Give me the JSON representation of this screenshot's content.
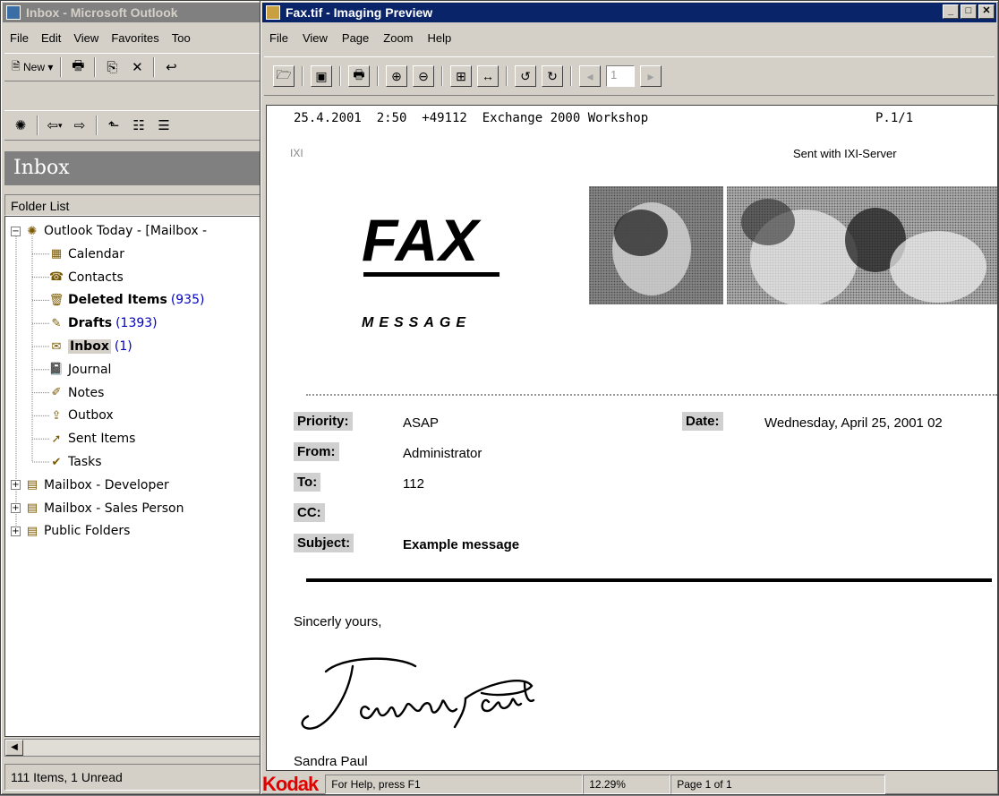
{
  "outlook": {
    "title": "Inbox - Microsoft Outlook",
    "menu": [
      "File",
      "Edit",
      "View",
      "Favorites",
      "Too"
    ],
    "toolbar1": {
      "new_label": "New"
    },
    "banner": "Inbox",
    "folder_header": "Folder List",
    "tree": [
      {
        "label": "Outlook Today - [Mailbox -",
        "icon": "outlook-today-icon",
        "level": 0,
        "expander": "-"
      },
      {
        "label": "Calendar",
        "icon": "calendar-icon",
        "level": 1
      },
      {
        "label": "Contacts",
        "icon": "contacts-icon",
        "level": 1
      },
      {
        "label": "Deleted Items",
        "count": "(935)",
        "bold": true,
        "icon": "deleted-items-icon",
        "level": 1
      },
      {
        "label": "Drafts",
        "count": "(1393)",
        "bold": true,
        "icon": "drafts-icon",
        "level": 1
      },
      {
        "label": "Inbox",
        "count": "(1)",
        "bold": true,
        "selected": true,
        "icon": "inbox-icon",
        "level": 1
      },
      {
        "label": "Journal",
        "icon": "journal-icon",
        "level": 1
      },
      {
        "label": "Notes",
        "icon": "notes-icon",
        "level": 1
      },
      {
        "label": "Outbox",
        "icon": "outbox-icon",
        "level": 1
      },
      {
        "label": "Sent Items",
        "icon": "sent-items-icon",
        "level": 1
      },
      {
        "label": "Tasks",
        "icon": "tasks-icon",
        "level": 1
      },
      {
        "label": "Mailbox - Developer",
        "icon": "mailbox-icon",
        "level": 0,
        "expander": "+"
      },
      {
        "label": "Mailbox - Sales Person",
        "icon": "mailbox-icon",
        "level": 0,
        "expander": "+"
      },
      {
        "label": "Public Folders",
        "icon": "public-folders-icon",
        "level": 0,
        "expander": "+"
      }
    ],
    "status": "111 Items, 1 Unread"
  },
  "imaging": {
    "title": "Fax.tif - Imaging Preview",
    "menu": [
      "File",
      "View",
      "Page",
      "Zoom",
      "Help"
    ],
    "page_input": "1",
    "status": {
      "brand": "Kodak",
      "help": "For Help, press F1",
      "zoom": "12.29%",
      "page": "Page 1 of 1"
    }
  },
  "fax": {
    "header_line": "25.4.2001  2:50  +49112  Exchange 2000 Workshop",
    "header_page": "P.1/1",
    "sent_with": "Sent with IXI-Server",
    "logo_text": "IXI",
    "heading": "FAX",
    "subheading": "MESSAGE",
    "fields": {
      "priority_label": "Priority:",
      "priority": "ASAP",
      "date_label": "Date:",
      "date": "Wednesday, April 25, 2001 02",
      "from_label": "From:",
      "from": "Administrator",
      "to_label": "To:",
      "to": "112",
      "cc_label": "CC:",
      "cc": "",
      "subject_label": "Subject:",
      "subject": "Example message"
    },
    "closing": "Sincerly yours,",
    "signature_text": "Sandra Paul",
    "signer": "Sandra Paul"
  }
}
